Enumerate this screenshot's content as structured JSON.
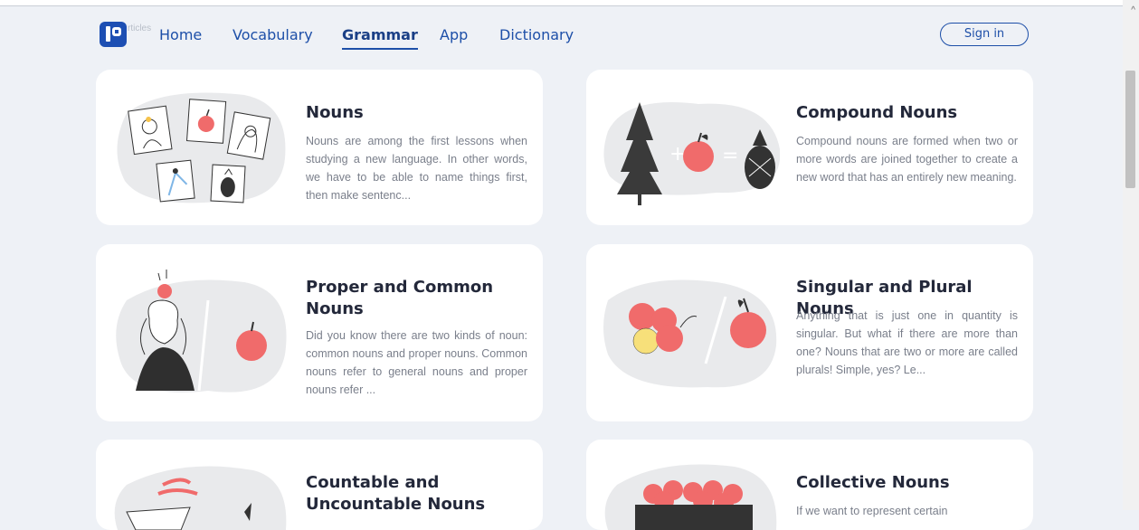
{
  "brand": {
    "logo_text": "rticles"
  },
  "nav": {
    "links": [
      "Home",
      "Vocabulary",
      "Grammar",
      "App",
      "Dictionary"
    ],
    "active": "Grammar",
    "signin_label": "Sign in"
  },
  "cards": [
    {
      "title": "Nouns",
      "description": "Nouns are among the first lessons when studying a new language. In other words, we have to be able to name things first, then make sentenc..."
    },
    {
      "title": "Compound Nouns",
      "description": "Compound nouns are formed when two or more words are joined together to create a new word that has an entirely new meaning."
    },
    {
      "title": "Proper and Common Nouns",
      "description": "Did you know there are two kinds of noun: common nouns and proper nouns. Common nouns refer to general nouns and proper nouns refer ..."
    },
    {
      "title": "Singular and Plural Nouns",
      "description": "Anything that is just one in quantity is singular. But what if there are more than one? Nouns that are two or more are called plurals! Simple, yes? Le..."
    },
    {
      "title": "Countable and Uncountable Nouns",
      "description": ""
    },
    {
      "title": "Collective Nouns",
      "description": "If we want to represent certain"
    }
  ],
  "colors": {
    "accent": "#1d4fa8",
    "apple": "#f06b6b",
    "background": "#eef1f6"
  }
}
